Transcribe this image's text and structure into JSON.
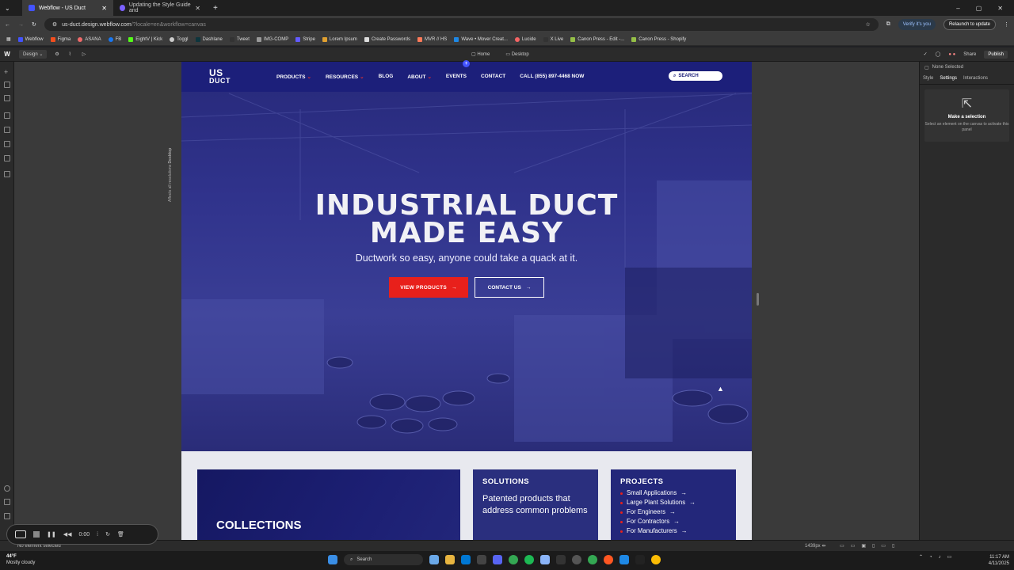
{
  "browser": {
    "tabs": [
      {
        "title": "Webflow - US Duct",
        "active": true
      },
      {
        "title": "Updating the Style Guide and ",
        "active": false
      }
    ],
    "url_host": "us-duct.design.webflow.com",
    "url_rest": "/?locale=en&workflow=canvas",
    "verify_label": "Verify it's you",
    "relaunch_label": "Relaunch to update",
    "bookmarks": [
      "Webflow",
      "Figma",
      "ASANA",
      "FB",
      "EightV | Kick",
      "Toggl",
      "Dashlane",
      "Tweet",
      "IMG-COMP",
      "Stripe",
      "Lorem Ipsum",
      "Create Passwords",
      "MVR // HS",
      "Wave • Mover Creat...",
      "Lucide",
      "X Live",
      "Canon Press - Edit -...",
      "Canon Press - Shopify"
    ]
  },
  "webflow": {
    "mode": "Design",
    "page": "Home",
    "breakpoint": "Desktop",
    "share": "Share",
    "publish": "Publish",
    "right_panel": {
      "selection": "None Selected",
      "tabs": [
        "Style",
        "Settings",
        "Interactions"
      ],
      "active_tab": "Settings",
      "empty_title": "Make a selection",
      "empty_sub": "Select an element on the canvas to activate this panel"
    },
    "breakpoint_note": "Affects all resolutions",
    "breakpoint_label": "Desktop",
    "width_readout": "1439px",
    "status_left": "No element selected"
  },
  "site": {
    "logo_line1": "US",
    "logo_line2": "DUCT",
    "nav": [
      "PRODUCTS",
      "RESOURCES",
      "BLOG",
      "ABOUT",
      "EVENTS",
      "CONTACT",
      "CALL (855) 897-4468 NOW"
    ],
    "search_label": "SEARCH",
    "headline_1": "INDUSTRIAL DUCT",
    "headline_2": "MADE EASY",
    "tagline": "Ductwork so easy, anyone could take a quack at it.",
    "cta_primary": "VIEW PRODUCTS",
    "cta_secondary": "CONTACT US",
    "cards": {
      "collections": "COLLECTIONS",
      "solutions_title": "SOLUTIONS",
      "solutions_body": "Patented products that address common problems",
      "projects_title": "PROJECTS",
      "projects_items": [
        "Small Applications",
        "Large Plant Solutions",
        "For Engineers",
        "For Contractors",
        "For Manufacturers"
      ]
    },
    "colors": {
      "navy": "#1c1f7a",
      "red": "#e8201b"
    }
  },
  "recorder": {
    "time": "0:00"
  },
  "taskbar": {
    "temp": "44°F",
    "weather": "Mostly cloudy",
    "search": "Search",
    "time": "11:17 AM",
    "date": "4/11/2025"
  }
}
